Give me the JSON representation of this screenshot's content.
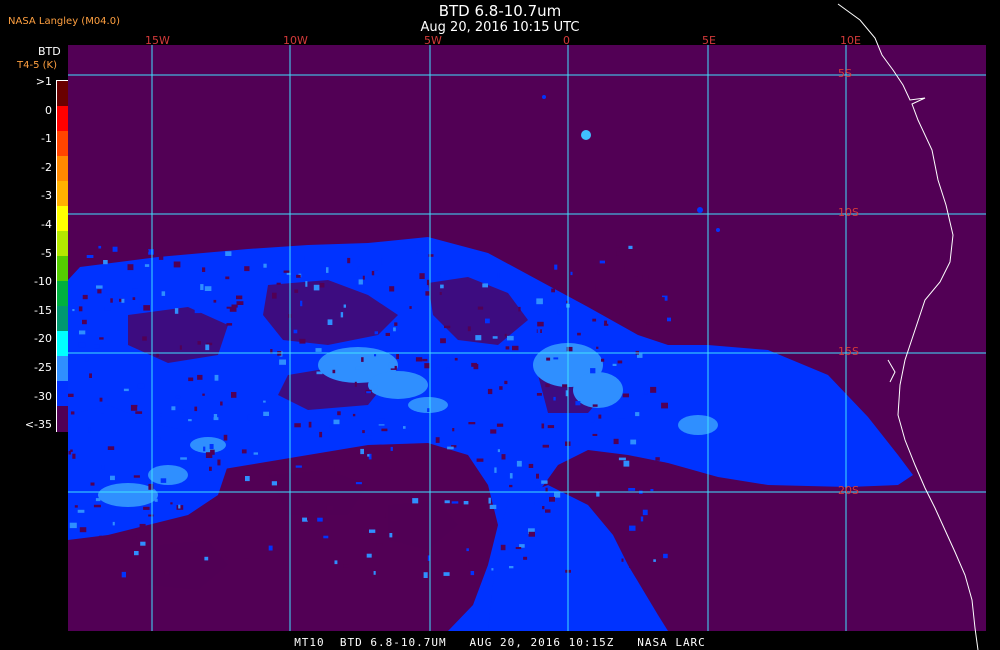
{
  "title": "BTD 6.8-10.7um",
  "subtitle": "Aug 20, 2016 10:15 UTC",
  "organization": "NASA Langley (M04.0)",
  "legend": {
    "title": "BTD",
    "unit_label": "T4-5 (K)",
    "labels": [
      ">1",
      "0",
      "-1",
      "-2",
      "-3",
      "-4",
      "-5",
      "-10",
      "-15",
      "-20",
      "-25",
      "-30",
      "<-35"
    ],
    "colors": [
      "#6a0000",
      "#ff0000",
      "#ff4400",
      "#ff8800",
      "#ffb000",
      "#ffff00",
      "#b4e800",
      "#55cc00",
      "#00b040",
      "#009870",
      "#00ffff",
      "#2f8fff",
      "#0030ff",
      "#520055"
    ]
  },
  "map": {
    "background_color": "#520055",
    "grid_color": "#40e0ff",
    "lon_labels": [
      "15W",
      "10W",
      "5W",
      "0",
      "5E",
      "10E"
    ],
    "lat_labels": [
      "5S",
      "10S",
      "15S",
      "20S"
    ],
    "label_color": "#d43a3a",
    "coastline_color": "#ffffff",
    "cloud_colors": [
      "#0033ff",
      "#2f8fff",
      "#40c0ff"
    ]
  },
  "footer": "MT10  BTD 6.8-10.7UM   AUG 20, 2016 10:15Z   NASA LARC"
}
